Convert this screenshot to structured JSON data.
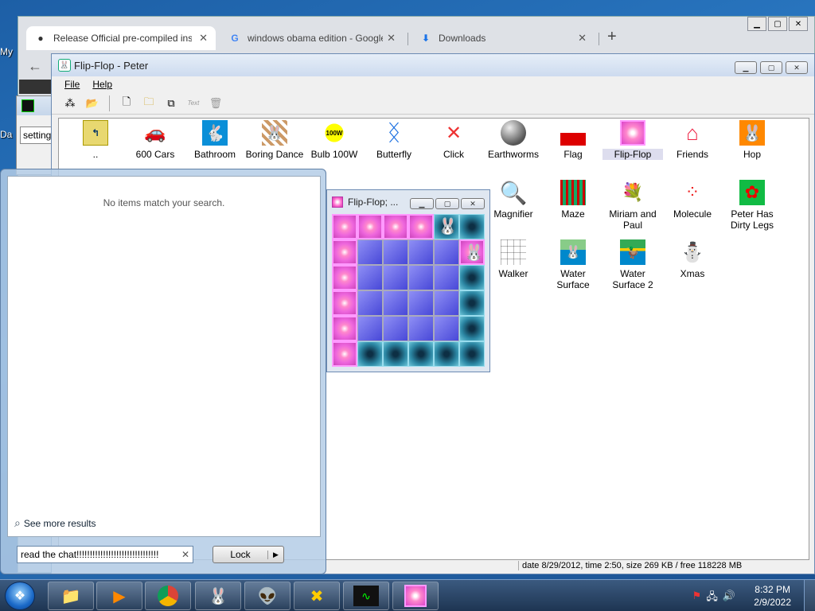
{
  "desktop": {
    "labels": [
      "My",
      "Da"
    ]
  },
  "chrome": {
    "tabs": [
      {
        "title": "Release Official pre-compiled ins",
        "icon": "github-icon"
      },
      {
        "title": "windows obama edition - Google",
        "icon": "google-icon"
      },
      {
        "title": "Downloads",
        "icon": "download-icon"
      }
    ],
    "new_tab": "+"
  },
  "mini_window": {
    "input_value": "setting"
  },
  "flipflop": {
    "title": "Flip-Flop - Peter",
    "menu": [
      "File",
      "Help"
    ],
    "toolbar": {
      "text_label": "Text"
    },
    "items": [
      {
        "label": "..",
        "icon": "up-folder-icon"
      },
      {
        "label": "600 Cars",
        "icon": "car-icon"
      },
      {
        "label": "Bathroom",
        "icon": "bunny-icon"
      },
      {
        "label": "Boring Dance",
        "icon": "dance-icon"
      },
      {
        "label": "Bulb 100W",
        "icon": "bulb-icon"
      },
      {
        "label": "Butterfly",
        "icon": "butterfly-icon"
      },
      {
        "label": "Click",
        "icon": "arrows-icon"
      },
      {
        "label": "Earthworms",
        "icon": "sphere-icon"
      },
      {
        "label": "Flag",
        "icon": "flag-icon"
      },
      {
        "label": "Flip-Flop",
        "icon": "pink-tile-icon"
      },
      {
        "label": "Friends",
        "icon": "house-icon"
      },
      {
        "label": "Hop",
        "icon": "bunny-icon"
      },
      {
        "label": "Magnifier",
        "icon": "magnifier-icon"
      },
      {
        "label": "Maze",
        "icon": "maze-icon"
      },
      {
        "label": "Miriam and Paul",
        "icon": "flowers-icon"
      },
      {
        "label": "Molecule",
        "icon": "molecule-icon"
      },
      {
        "label": "Peter Has Dirty Legs",
        "icon": "flower-icon"
      },
      {
        "label": "Walker",
        "icon": "grid-icon"
      },
      {
        "label": "Water Surface",
        "icon": "water-icon"
      },
      {
        "label": "Water Surface 2",
        "icon": "duck-icon"
      },
      {
        "label": "Xmas",
        "icon": "snowman-icon"
      }
    ],
    "status": "date 8/29/2012, time 2:50, size 269 KB / free 118228 MB"
  },
  "game": {
    "title": "Flip-Flop; ..."
  },
  "start_menu": {
    "no_items": "No items match your search.",
    "see_more": "See more results",
    "search_value": "read the chat!!!!!!!!!!!!!!!!!!!!!!!!!!!!!!!",
    "lock_label": "Lock"
  },
  "taskbar": {
    "time": "8:32 PM",
    "date": "2/9/2022"
  }
}
